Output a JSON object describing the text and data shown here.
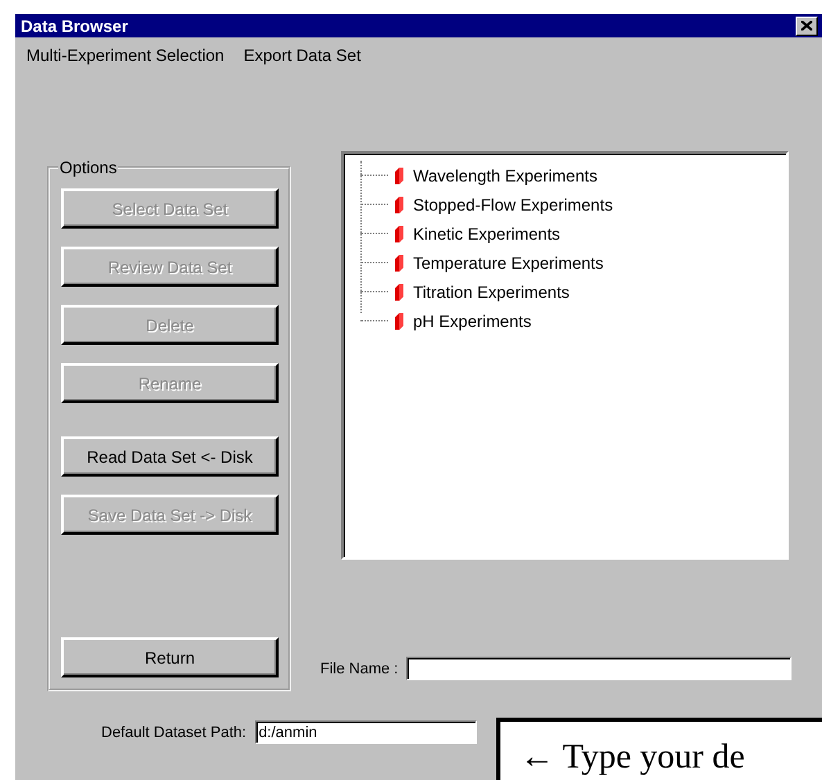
{
  "window": {
    "title": "Data Browser"
  },
  "menu": [
    {
      "label": "Multi-Experiment Selection"
    },
    {
      "label": "Export Data Set"
    }
  ],
  "options": {
    "title": "Options",
    "buttons": [
      {
        "label": "Select Data Set",
        "disabled": true
      },
      {
        "label": "Review Data Set",
        "disabled": true
      },
      {
        "label": "Delete",
        "disabled": true
      },
      {
        "label": "Rename",
        "disabled": true
      },
      {
        "label": "Read Data Set <- Disk",
        "disabled": false
      },
      {
        "label": "Save Data Set -> Disk",
        "disabled": true
      }
    ],
    "return_button": {
      "label": "Return",
      "disabled": false
    }
  },
  "tree": {
    "items": [
      {
        "label": "Wavelength Experiments"
      },
      {
        "label": "Stopped-Flow Experiments"
      },
      {
        "label": "Kinetic Experiments"
      },
      {
        "label": "Temperature Experiments"
      },
      {
        "label": "Titration Experiments"
      },
      {
        "label": "pH Experiments"
      }
    ]
  },
  "file_name": {
    "label": "File Name :"
  },
  "default_path": {
    "label": "Default Dataset Path:",
    "value": "d:/anmin"
  },
  "callout": {
    "text": "← Type your de"
  }
}
